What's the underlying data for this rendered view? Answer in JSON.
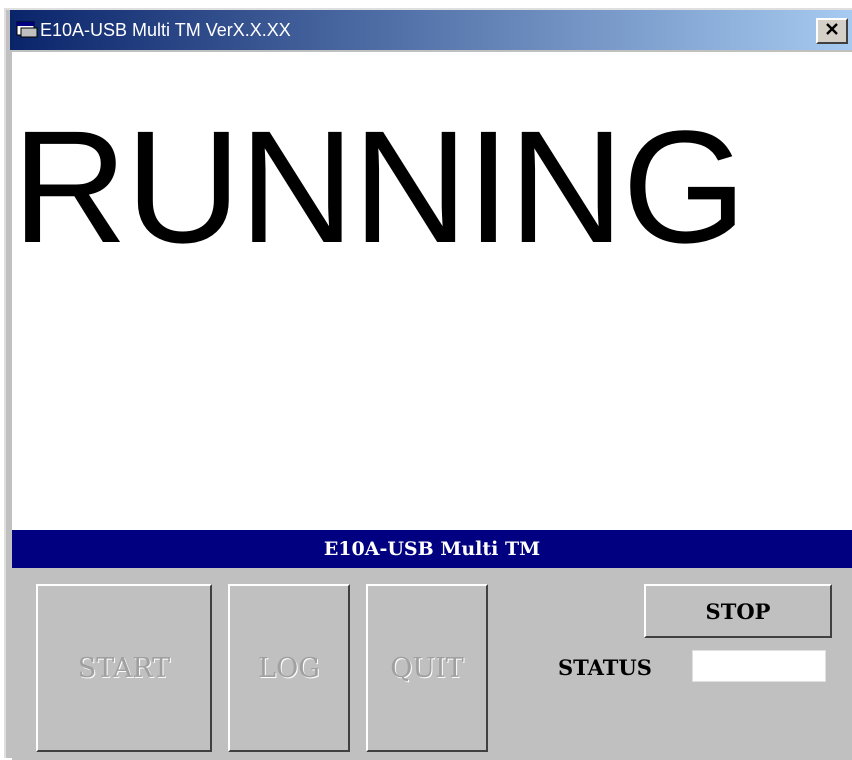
{
  "window": {
    "title": "E10A-USB Multi TM VerX.X.XX",
    "close_label": "✕"
  },
  "display": {
    "state_text": "RUNNING"
  },
  "banner": {
    "title": "E10A-USB Multi TM"
  },
  "controls": {
    "start_label": "START",
    "log_label": "LOG",
    "quit_label": "QUIT",
    "stop_label": "STOP",
    "status_label": "STATUS",
    "status_value": ""
  },
  "icons": {
    "app": "app-window-icon",
    "close": "close-icon"
  },
  "colors": {
    "title_gradient_start": "#0a246a",
    "title_gradient_end": "#a6caf0",
    "banner_bg": "#000080",
    "panel_bg": "#c0c0c0"
  }
}
